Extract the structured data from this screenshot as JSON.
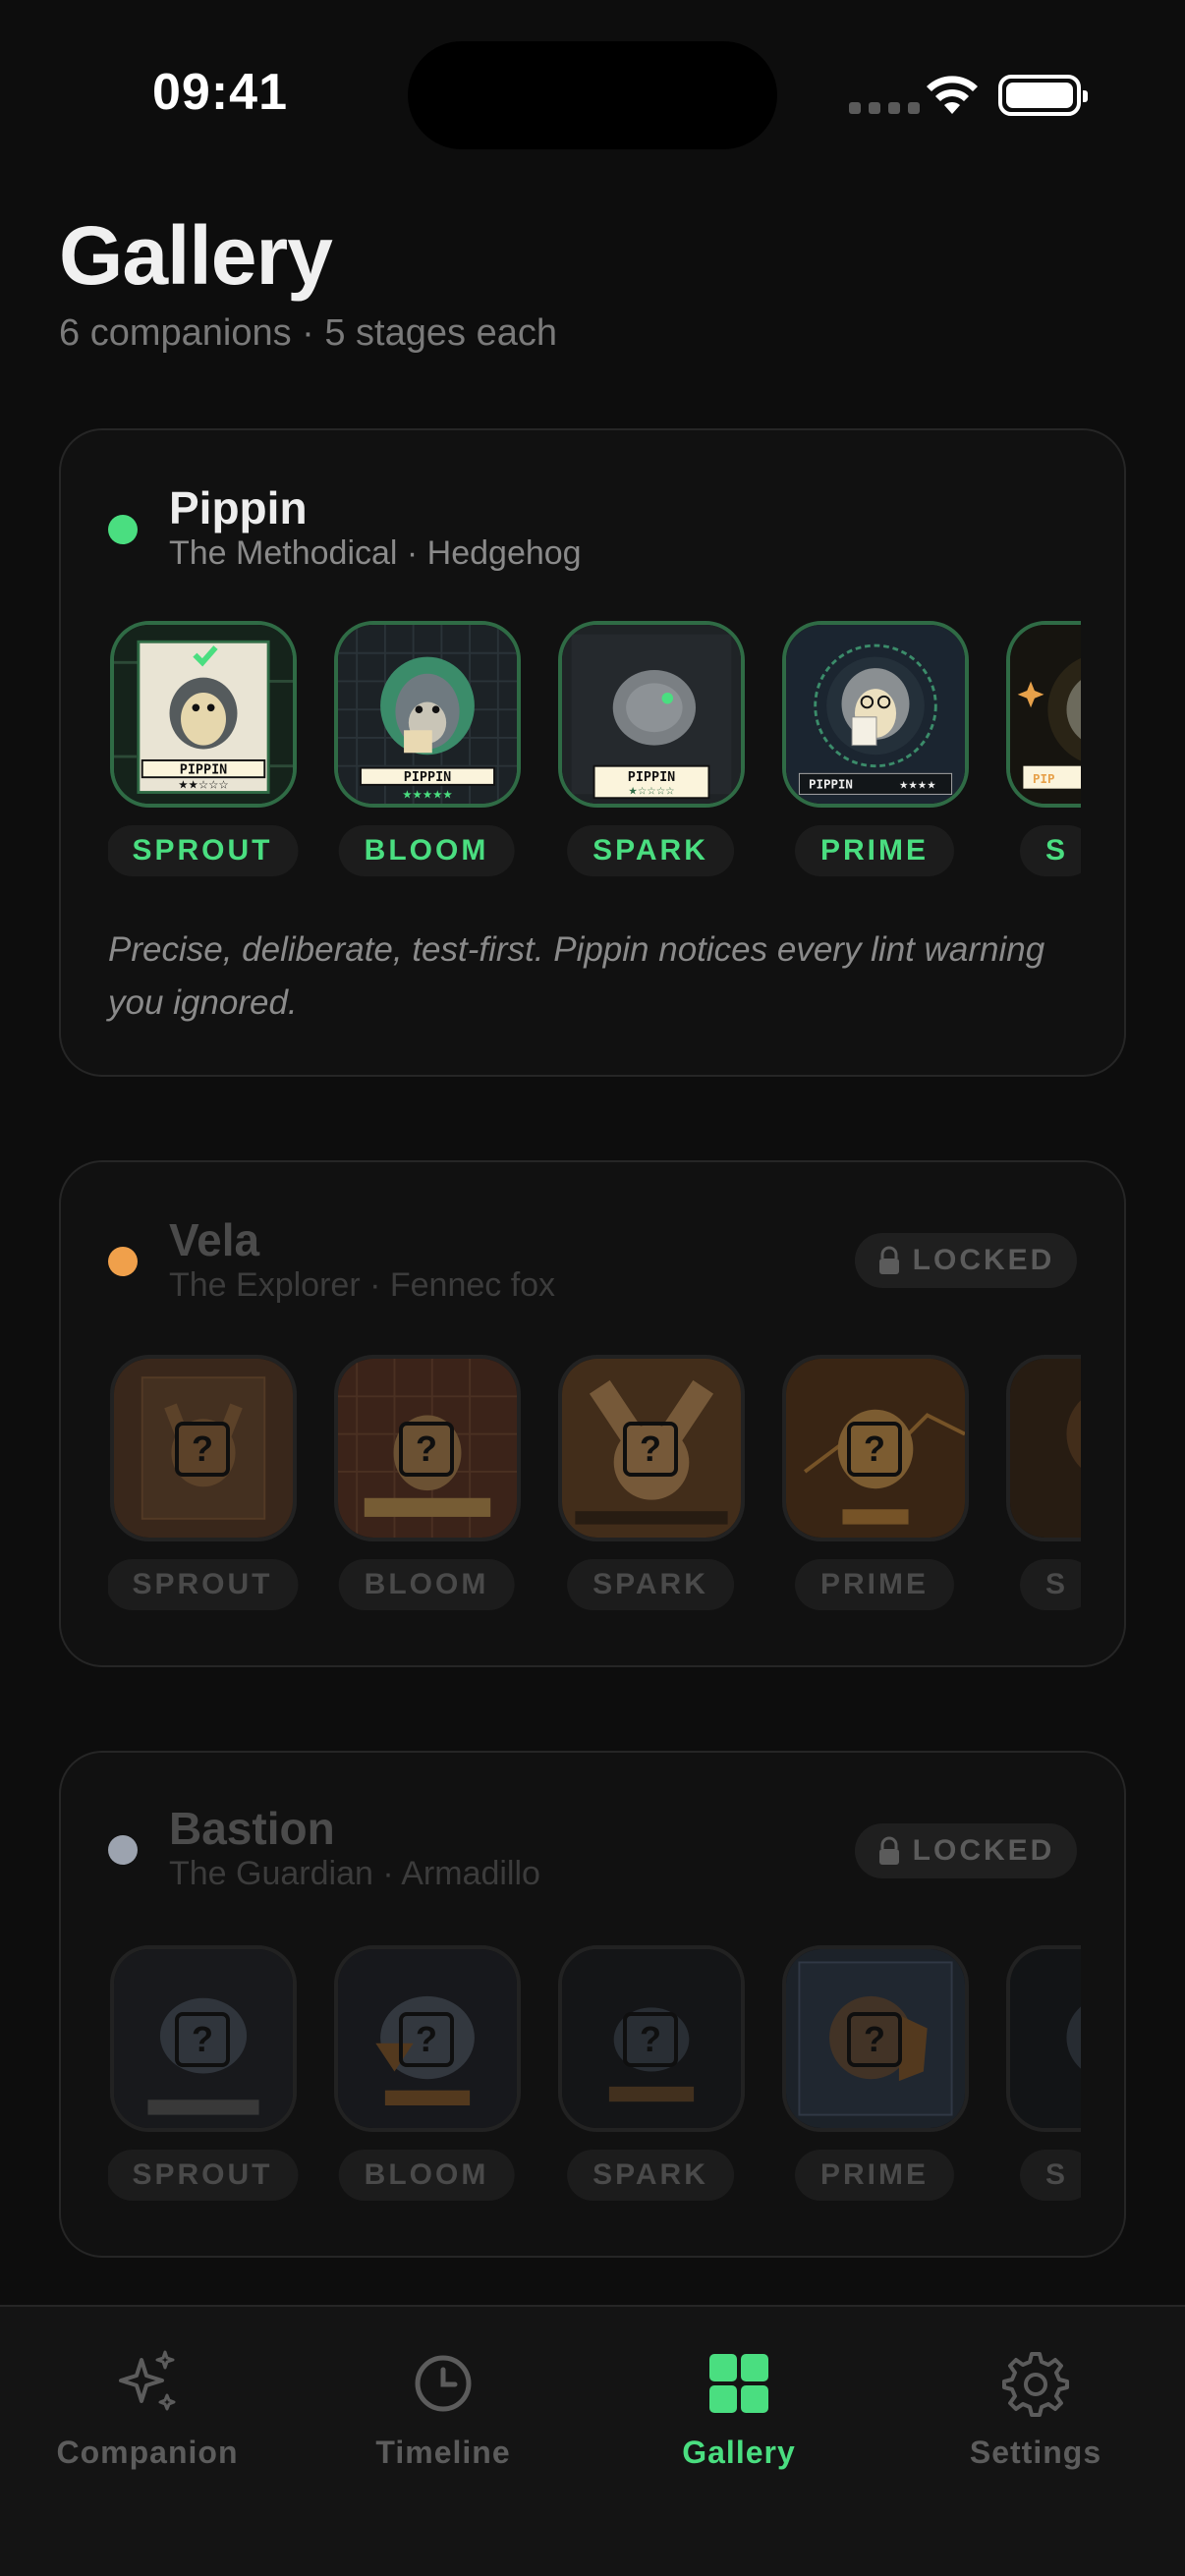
{
  "status_bar": {
    "time": "09:41"
  },
  "header": {
    "title": "Gallery",
    "subtitle": "6 companions · 5 stages each"
  },
  "companions": [
    {
      "name": "Pippin",
      "tagline": "The Methodical · Hedgehog",
      "dot_color": "#4ade80",
      "locked": false,
      "description": "Precise, deliberate, test-first. Pippin notices every lint warning you ignored.",
      "card_name_plates": [
        "PIPPIN",
        "PIPPIN",
        "PIPPIN",
        "PIPPIN",
        "PIP"
      ],
      "stages": [
        "SPROUT",
        "BLOOM",
        "SPARK",
        "PRIME",
        "S"
      ]
    },
    {
      "name": "Vela",
      "tagline": "The Explorer · Fennec fox",
      "dot_color": "#f0a04b",
      "locked": true,
      "lock_label": "LOCKED",
      "stages": [
        "SPROUT",
        "BLOOM",
        "SPARK",
        "PRIME",
        "S"
      ]
    },
    {
      "name": "Bastion",
      "tagline": "The Guardian · Armadillo",
      "dot_color": "#9ca3af",
      "locked": true,
      "lock_label": "LOCKED",
      "stages": [
        "SPROUT",
        "BLOOM",
        "SPARK",
        "PRIME",
        "S"
      ]
    }
  ],
  "tabs": [
    {
      "label": "Companion",
      "icon": "sparkles-icon",
      "active": false
    },
    {
      "label": "Timeline",
      "icon": "clock-icon",
      "active": false
    },
    {
      "label": "Gallery",
      "icon": "grid-icon",
      "active": true
    },
    {
      "label": "Settings",
      "icon": "gear-icon",
      "active": false
    }
  ],
  "colors": {
    "accent": "#4ade80",
    "background": "#0d0d0d",
    "card": "#111111"
  }
}
